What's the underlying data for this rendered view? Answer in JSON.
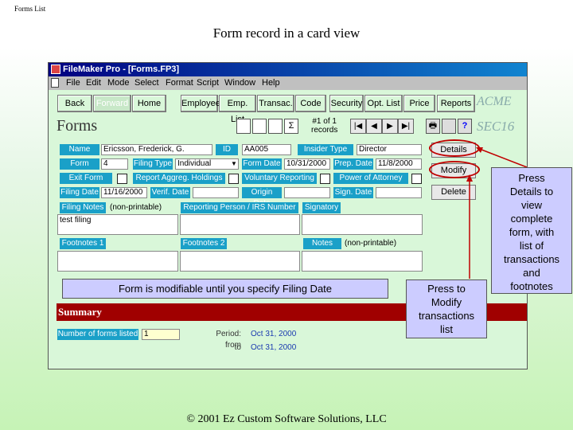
{
  "slide": {
    "tag": "Forms List",
    "title": "Form record in a card view",
    "footer": "© 2001 Ez Custom Software Solutions, LLC"
  },
  "window": {
    "title": "FileMaker Pro - [Forms.FP3]",
    "menu": [
      "File",
      "Edit",
      "Mode",
      "Select",
      "Format",
      "Script",
      "Window",
      "Help"
    ]
  },
  "nav": {
    "back": "Back",
    "forward": "Forward",
    "home": "Home",
    "buttons": [
      "Employee",
      "Emp. List",
      "Transac.",
      "Code",
      "Security",
      "Opt. List",
      "Price",
      "Reports"
    ],
    "brand": "ACME",
    "section": "SEC16",
    "layout_title": "Forms",
    "record_line1": "#1 of 1",
    "record_line2": "records",
    "sigma": "Σ",
    "help": "?"
  },
  "record": {
    "name_label": "Name",
    "name": "Ericsson, Frederick, G.",
    "id_label": "ID",
    "id": "AA005",
    "insider_type_label": "Insider Type",
    "insider_type": "Director",
    "form_label": "Form",
    "form": "4",
    "filing_type_label": "Filing Type",
    "filing_type": "Individual",
    "form_date_label": "Form Date",
    "form_date": "10/31/2000",
    "prep_date_label": "Prep. Date",
    "prep_date": "11/8/2000",
    "exit_form_label": "Exit Form",
    "report_aggreg_label": "Report Aggreg. Holdings",
    "voluntary_label": "Voluntary Reporting",
    "power_label": "Power of Attorney",
    "filing_date_label": "Filing Date",
    "filing_date": "11/16/2000",
    "verif_date_label": "Verif. Date",
    "verif_date": "",
    "origin_date_label": "Origin Date",
    "origin_date": "",
    "sign_date_label": "Sign. Date",
    "sign_date": "",
    "filing_notes_label": "Filing Notes",
    "filing_notes_note": "(non-printable)",
    "filing_notes": "test filing",
    "reporting_label": "Reporting Person / IRS Number",
    "signatory_label": "Signatory",
    "footnotes1_label": "Footnotes 1",
    "footnotes2_label": "Footnotes 2",
    "notes_label": "Notes",
    "notes_note": "(non-printable)"
  },
  "side_buttons": {
    "details": "Details",
    "modify": "Modify",
    "delete": "Delete"
  },
  "summary": {
    "title": "Summary",
    "count_label": "Number of forms listed",
    "count": "1",
    "period_from_label": "Period: from",
    "period_from": "Oct 31, 2000",
    "period_to_label": "to",
    "period_to": "Oct 31, 2000"
  },
  "callouts": {
    "modifiable": "Form is modifiable until you specify Filing Date",
    "modify_lines": [
      "Press to",
      "Modify",
      "transactions",
      "list"
    ],
    "details_lines": [
      "Press",
      "Details to",
      "view",
      "complete",
      "form, with",
      "list of",
      "transactions",
      "and",
      "footnotes"
    ]
  },
  "colors": {
    "label_bg": "#1aa0c8",
    "summary_bg": "#a00000",
    "callout_bg": "#ccccff",
    "annotation_red": "#c00000"
  }
}
